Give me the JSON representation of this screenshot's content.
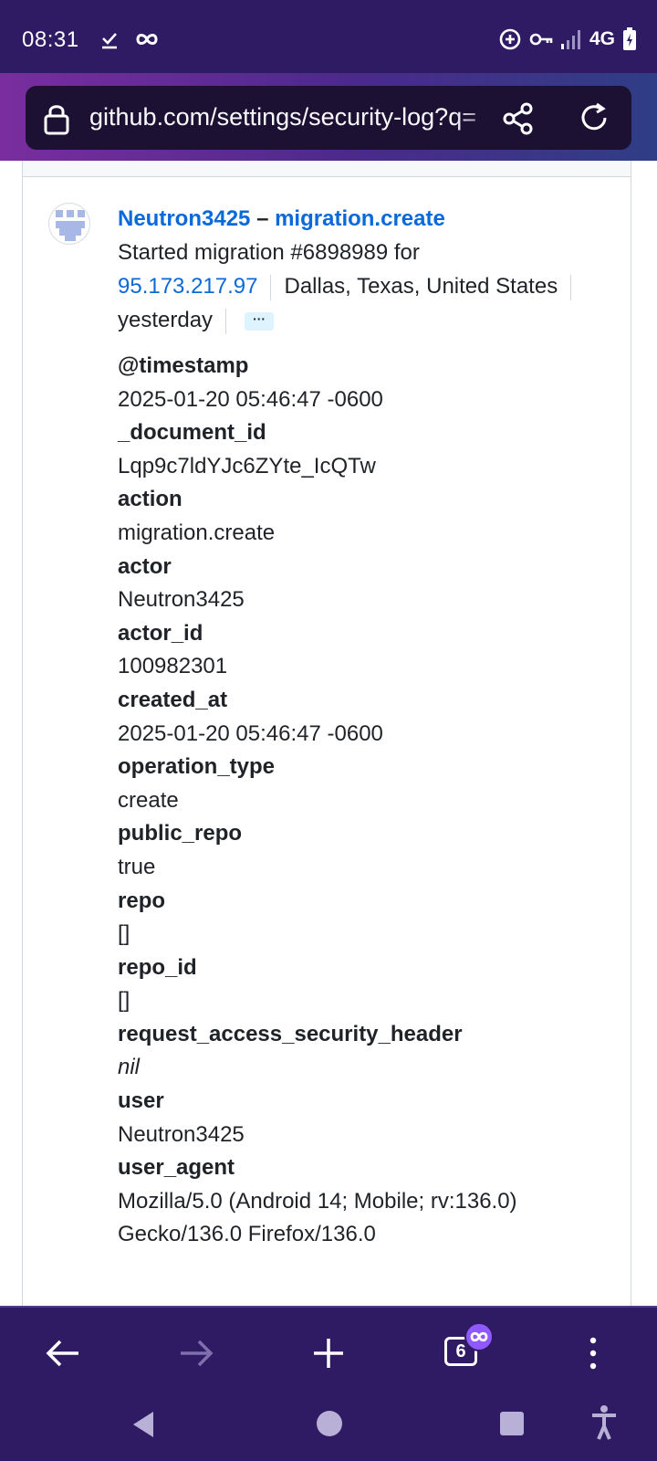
{
  "status_bar": {
    "time": "08:31",
    "network": "4G",
    "left_icons": [
      "check-download-icon",
      "infinity-icon"
    ],
    "right_icons": [
      "data-saver-icon",
      "vpn-key-icon",
      "signal-icon",
      "battery-charging-icon"
    ]
  },
  "browser": {
    "url": "github.com/settings/security-log?q=",
    "tab_count": "6"
  },
  "entry": {
    "actor": "Neutron3425",
    "separator": "–",
    "action": "migration.create",
    "description": "Started migration #6898989 for",
    "ip": "95.173.217.97",
    "location": "Dallas, Texas, United States",
    "time_ago": "yesterday",
    "more_label": "···"
  },
  "fields": [
    {
      "key": "@timestamp",
      "value": "2025-01-20 05:46:47 -0600"
    },
    {
      "key": "_document_id",
      "value": "Lqp9c7ldYJc6ZYte_IcQTw"
    },
    {
      "key": "action",
      "value": "migration.create"
    },
    {
      "key": "actor",
      "value": "Neutron3425"
    },
    {
      "key": "actor_id",
      "value": "100982301"
    },
    {
      "key": "created_at",
      "value": "2025-01-20 05:46:47 -0600"
    },
    {
      "key": "operation_type",
      "value": "create"
    },
    {
      "key": "public_repo",
      "value": "true"
    },
    {
      "key": "repo",
      "value": "[]"
    },
    {
      "key": "repo_id",
      "value": "[]"
    },
    {
      "key": "request_access_security_header",
      "value": "nil"
    },
    {
      "key": "user",
      "value": "Neutron3425"
    },
    {
      "key": "user_agent",
      "value": "Mozilla/5.0 (Android 14; Mobile; rv:136.0) Gecko/136.0 Firefox/136.0"
    }
  ],
  "colors": {
    "chrome": "#2f1b63",
    "link": "#0969da",
    "private_accent": "#9059ff"
  }
}
